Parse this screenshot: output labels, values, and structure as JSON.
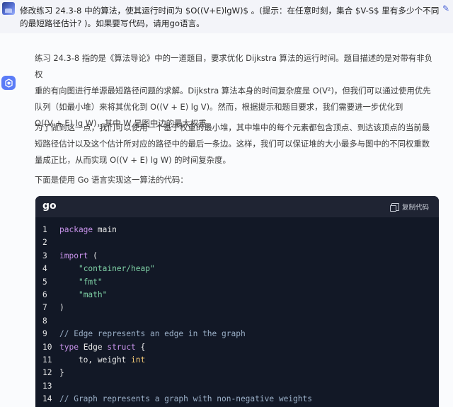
{
  "user_message": {
    "text": "修改练习 24.3-8 中的算法，使其运行时间为 $O((V+E)lgW)$ 。(提示：在任意时刻，集合 $V-S$ 里有多少个不同的最短路径估计? )。如果要写代码，请用go语言。"
  },
  "answer": {
    "p1": [
      "练习 24.3-8 指的是《算法导论》中的一道题目，要求优化 Dijkstra 算法的运行时间。题目描述的是对带有非负权",
      "重的有向图进行单源最短路径问题的求解。Dijkstra 算法本身的时间复杂度是 O(V²)，但我们可以通过使用优先",
      "队列（如最小堆）来将其优化到 O((V + E) lg V)。然而，根据提示和题目要求，我们需要进一步优化到",
      "O((V + E) lg W)，其中 W 是图中边的最大权重。"
    ],
    "p2": [
      "为了做到这一点，我们可以使用一个基于权重的最小堆，其中堆中的每个元素都包含顶点、到达该顶点的当前最",
      "短路径估计以及这个估计所对应的路径中的最后一条边。这样，我们可以保证堆的大小最多与图中的不同权重数",
      "量成正比，从而实现 O((V + E) lg W) 的时间复杂度。"
    ],
    "p3": "下面是使用 Go 语言实现这一算法的代码："
  },
  "code_block": {
    "language": "go",
    "copy_label": "复制代码",
    "lines": [
      "package main",
      "",
      "import (",
      "    \"container/heap\"",
      "    \"fmt\"",
      "    \"math\"",
      ")",
      "",
      "// Edge represents an edge in the graph",
      "type Edge struct {",
      "    to, weight int",
      "}",
      "",
      "// Graph represents a graph with non-negative weights"
    ],
    "line_numbers": [
      "1",
      "2",
      "3",
      "4",
      "5",
      "6",
      "7",
      "8",
      "9",
      "10",
      "11",
      "12",
      "13",
      "14"
    ]
  }
}
